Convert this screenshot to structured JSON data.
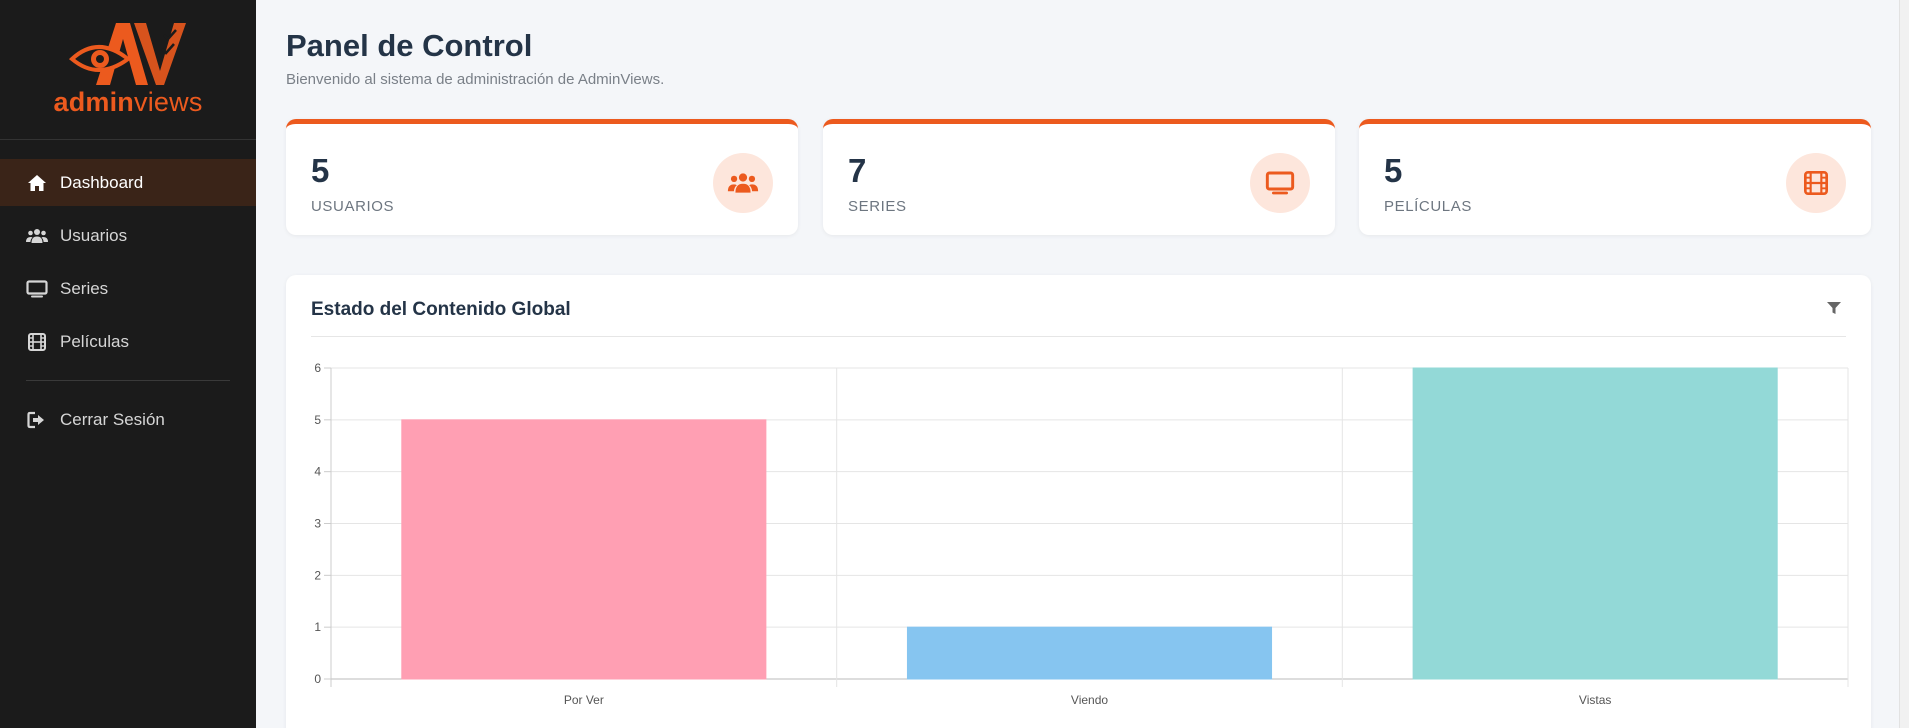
{
  "brand": {
    "text_bold": "admin",
    "text_light": "views"
  },
  "sidebar": {
    "items": [
      {
        "label": "Dashboard",
        "icon": "home-icon",
        "active": true
      },
      {
        "label": "Usuarios",
        "icon": "users-icon",
        "active": false
      },
      {
        "label": "Series",
        "icon": "tv-icon",
        "active": false
      },
      {
        "label": "Películas",
        "icon": "film-icon",
        "active": false
      }
    ],
    "logout_label": "Cerrar Sesión"
  },
  "header": {
    "title": "Panel de Control",
    "subtitle": "Bienvenido al sistema de administración de AdminViews."
  },
  "stats": [
    {
      "value": "5",
      "label": "USUARIOS",
      "icon": "users-icon"
    },
    {
      "value": "7",
      "label": "SERIES",
      "icon": "tv-icon"
    },
    {
      "value": "5",
      "label": "PELÍCULAS",
      "icon": "film-icon"
    }
  ],
  "colors": {
    "accent": "#ec5a1e",
    "sidebar_bg": "#1b1b1b",
    "bar_por_ver": "#ff9fb3",
    "bar_viendo": "#86c5f0",
    "bar_vistas": "#93d9d7"
  },
  "chart_panel": {
    "title": "Estado del Contenido Global"
  },
  "chart_data": {
    "type": "bar",
    "title": "",
    "categories": [
      "Por Ver",
      "Viendo",
      "Vistas"
    ],
    "values": [
      5,
      1,
      6
    ],
    "colors": [
      "#ff9fb3",
      "#86c5f0",
      "#93d9d7"
    ],
    "yticks": [
      0,
      1,
      2,
      3,
      4,
      5,
      6
    ],
    "ylim": [
      0,
      6
    ],
    "grid": true,
    "xlabel": "",
    "ylabel": ""
  }
}
